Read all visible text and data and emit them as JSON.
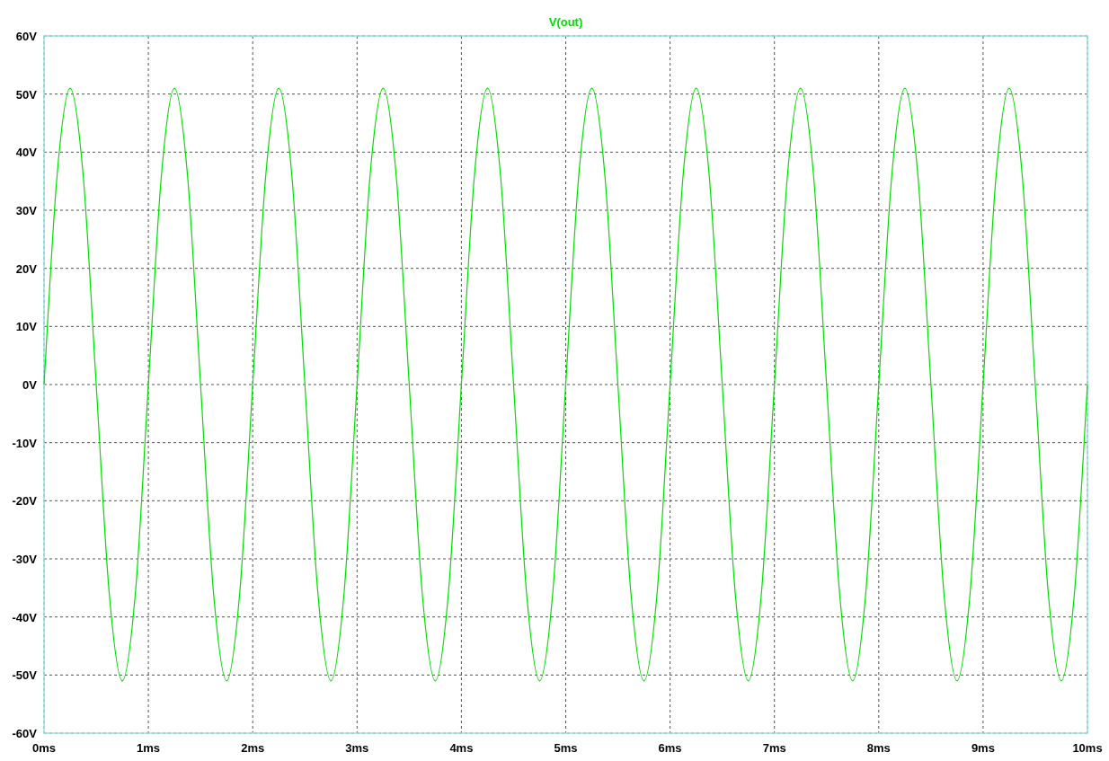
{
  "plot": {
    "chart_data": {
      "type": "line",
      "grid": true,
      "x": [
        0,
        0.125,
        0.25,
        0.375,
        0.5,
        0.625,
        0.75,
        0.875,
        1,
        1.125,
        1.25,
        1.375,
        1.5,
        1.625,
        1.75,
        1.875,
        2,
        2.125,
        2.25,
        2.375,
        2.5,
        2.625,
        2.75,
        2.875,
        3,
        3.125,
        3.25,
        3.375,
        3.5,
        3.625,
        3.75,
        3.875,
        4,
        4.125,
        4.25,
        4.375,
        4.5,
        4.625,
        4.75,
        4.875,
        5,
        5.125,
        5.25,
        5.375,
        5.5,
        5.625,
        5.75,
        5.875,
        6,
        6.125,
        6.25,
        6.375,
        6.5,
        6.625,
        6.75,
        6.875,
        7,
        7.125,
        7.25,
        7.375,
        7.5,
        7.625,
        7.75,
        7.875,
        8,
        8.125,
        8.25,
        8.375,
        8.5,
        8.625,
        8.75,
        8.875,
        9,
        9.125,
        9.25,
        9.375,
        9.5,
        9.625,
        9.75,
        9.875,
        10
      ],
      "series": [
        {
          "name": "V(out)",
          "color": "#00dd00",
          "values": [
            0,
            36,
            51,
            36,
            0,
            -36,
            -51,
            -36,
            0,
            36,
            51,
            36,
            0,
            -36,
            -51,
            -36,
            0,
            36,
            51,
            36,
            0,
            -36,
            -51,
            -36,
            0,
            36,
            51,
            36,
            0,
            -36,
            -51,
            -36,
            0,
            36,
            51,
            36,
            0,
            -36,
            -51,
            -36,
            0,
            36,
            51,
            36,
            0,
            -36,
            -51,
            -36,
            0,
            36,
            51,
            36,
            0,
            -36,
            -51,
            -36,
            0,
            36,
            51,
            36,
            0,
            -36,
            -51,
            -36,
            0,
            36,
            51,
            36,
            0,
            -36,
            -51,
            -36,
            0,
            36,
            51,
            36,
            0,
            -36,
            -51,
            -36,
            0
          ]
        }
      ],
      "xlim": [
        0,
        10
      ],
      "ylim": [
        -60,
        60
      ],
      "xticks": [
        {
          "value": 0,
          "label": "0ms"
        },
        {
          "value": 1,
          "label": "1ms"
        },
        {
          "value": 2,
          "label": "2ms"
        },
        {
          "value": 3,
          "label": "3ms"
        },
        {
          "value": 4,
          "label": "4ms"
        },
        {
          "value": 5,
          "label": "5ms"
        },
        {
          "value": 6,
          "label": "6ms"
        },
        {
          "value": 7,
          "label": "7ms"
        },
        {
          "value": 8,
          "label": "8ms"
        },
        {
          "value": 9,
          "label": "9ms"
        },
        {
          "value": 10,
          "label": "10ms"
        }
      ],
      "yticks": [
        {
          "value": 60,
          "label": "60V"
        },
        {
          "value": 50,
          "label": "50V"
        },
        {
          "value": 40,
          "label": "40V"
        },
        {
          "value": 30,
          "label": "30V"
        },
        {
          "value": 20,
          "label": "20V"
        },
        {
          "value": 10,
          "label": "10V"
        },
        {
          "value": 0,
          "label": "0V"
        },
        {
          "value": -10,
          "label": "-10V"
        },
        {
          "value": -20,
          "label": "-20V"
        },
        {
          "value": -30,
          "label": "-30V"
        },
        {
          "value": -40,
          "label": "-40V"
        },
        {
          "value": -50,
          "label": "-50V"
        },
        {
          "value": -60,
          "label": "-60V"
        }
      ]
    }
  }
}
